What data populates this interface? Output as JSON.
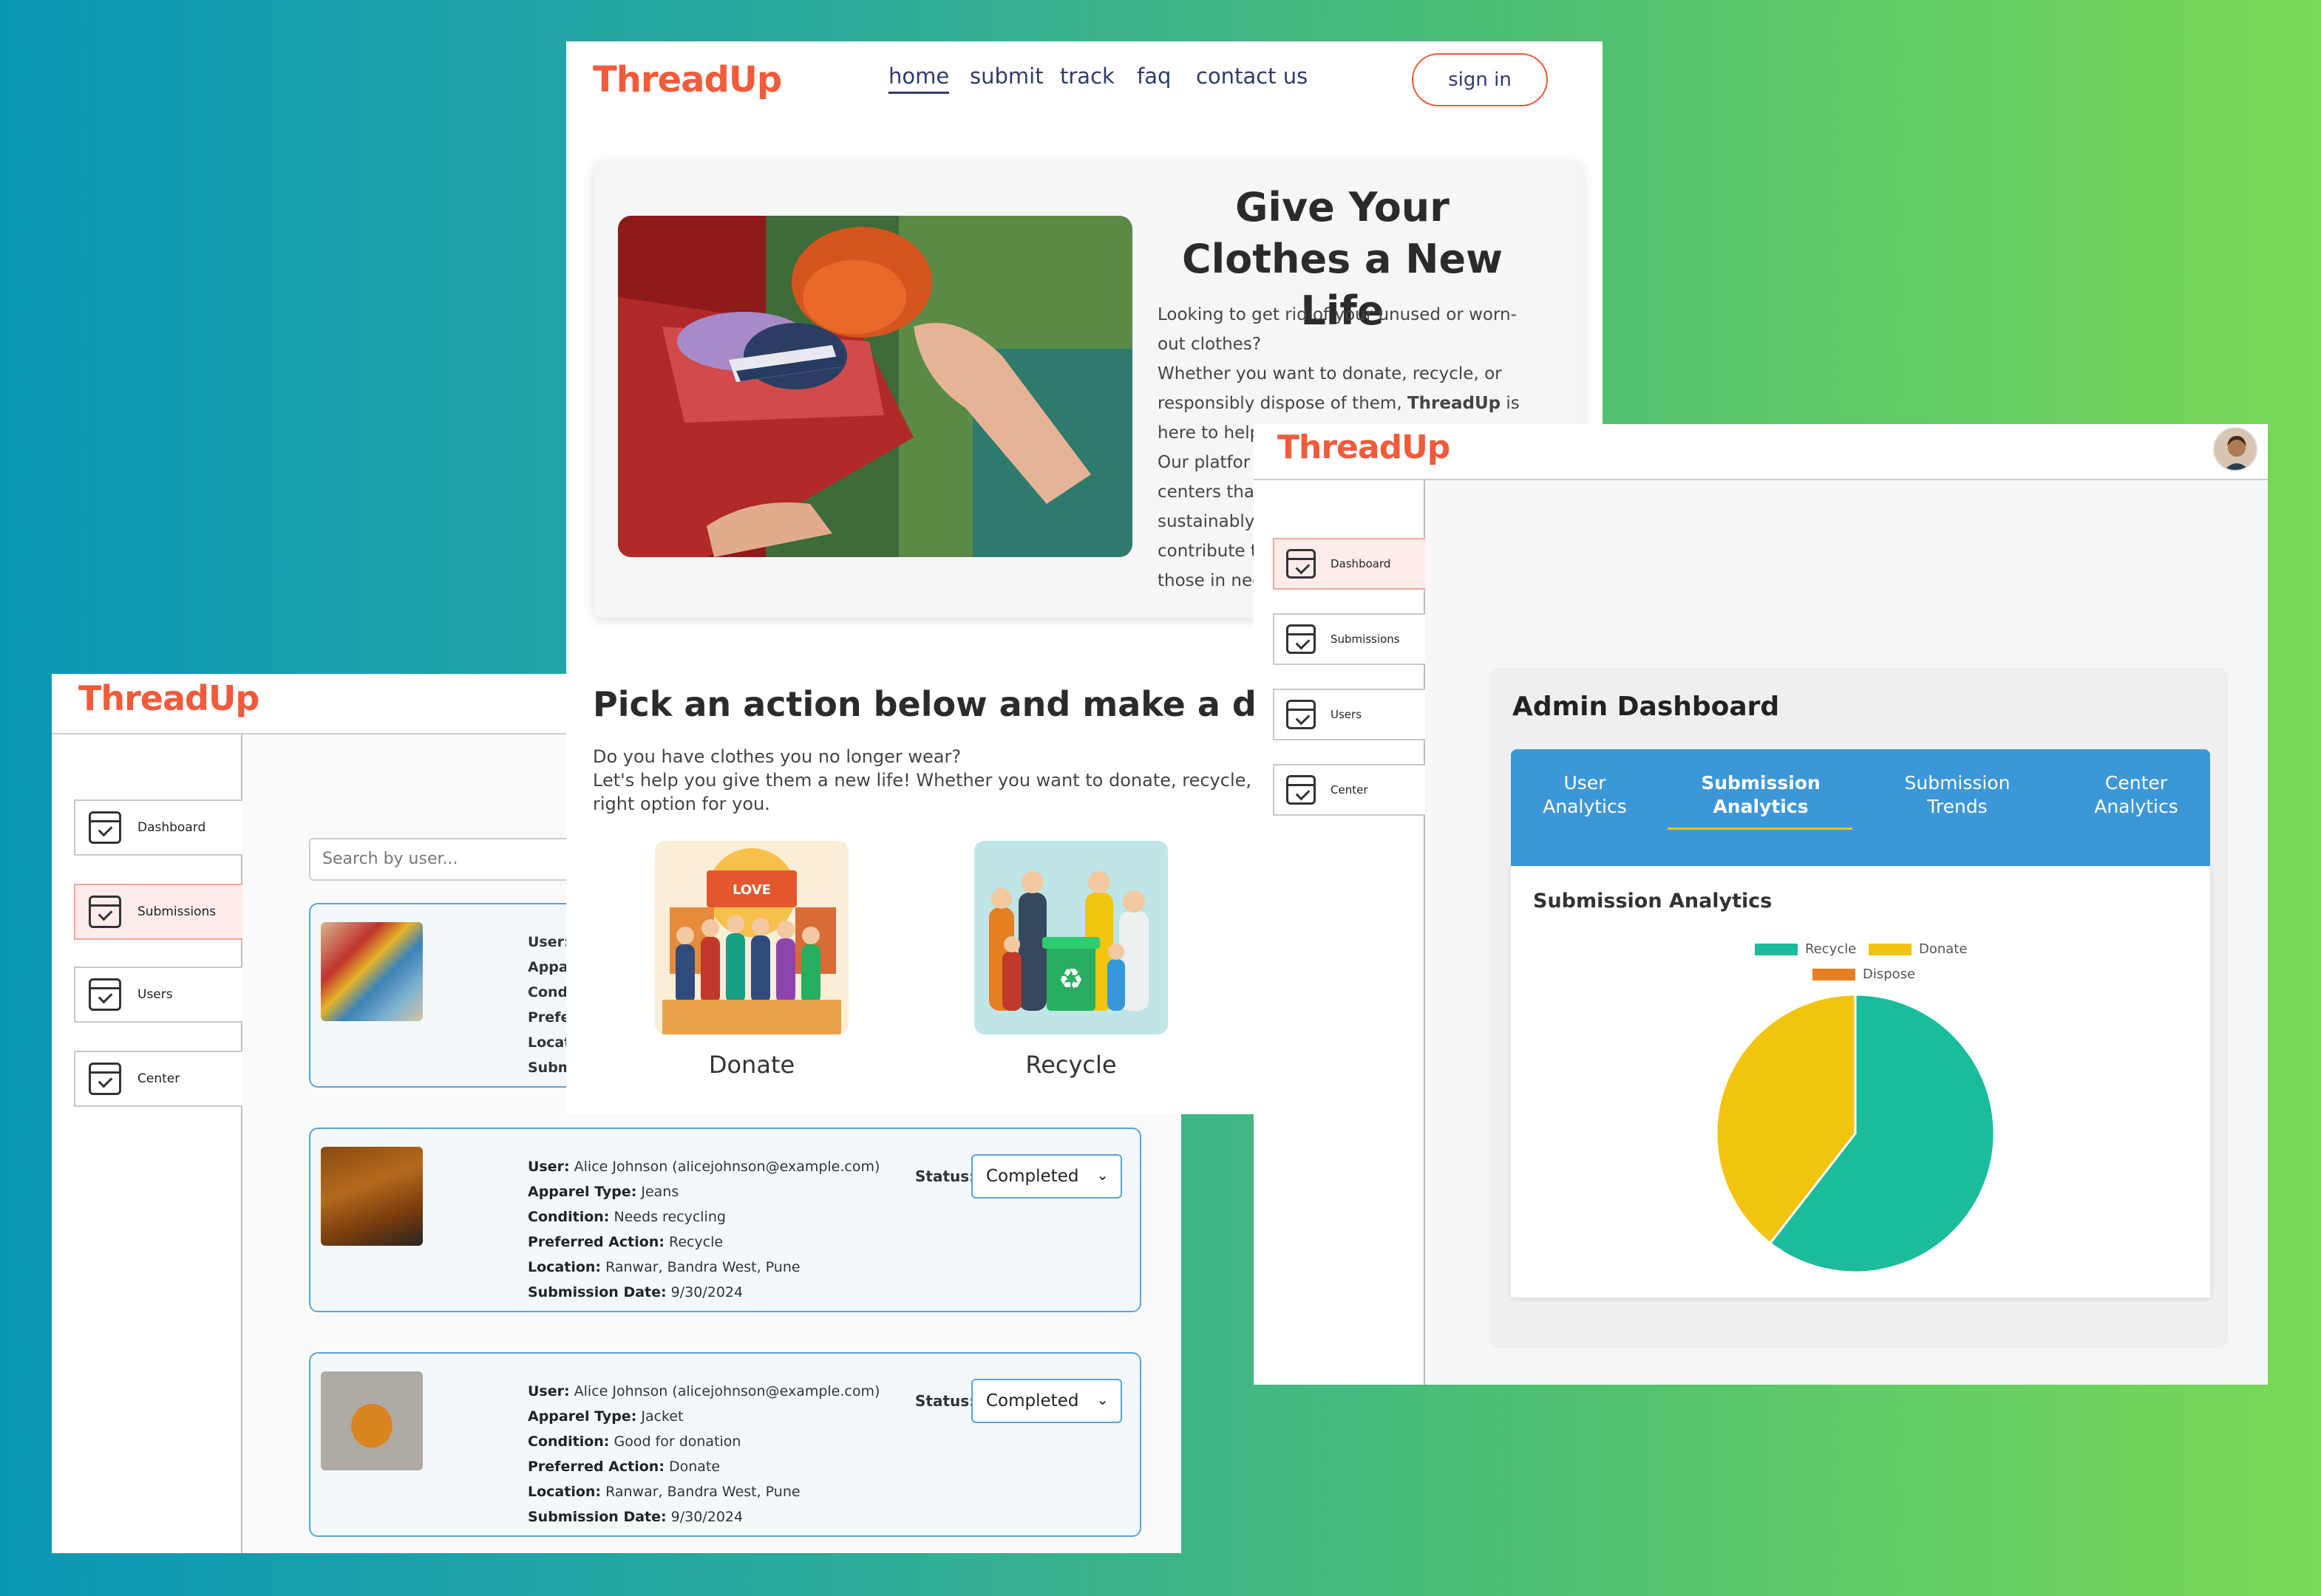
{
  "brand": "ThreadUp",
  "colors": {
    "brand": "#f15a3a",
    "accent": "#3c97d8",
    "recycle": "#1abc9c",
    "donate": "#f1c40f",
    "dispose": "#e67e22"
  },
  "submissions_window": {
    "sidebar": [
      "Dashboard",
      "Submissions",
      "Users",
      "Center"
    ],
    "search_placeholder": "Search by user...",
    "first_card_labels": [
      "User:",
      "Appa",
      "Condi",
      "Prefe",
      "Locat",
      "Subm"
    ],
    "cards": [
      {
        "user_label": "User:",
        "user": "Alice Johnson (alicejohnson@example.com)",
        "apparel_label": "Apparel Type:",
        "apparel": "Jeans",
        "condition_label": "Condition:",
        "condition": "Needs recycling",
        "action_label": "Preferred Action:",
        "action": "Recycle",
        "location_label": "Location:",
        "location": "Ranwar, Bandra West, Pune",
        "date_label": "Submission Date:",
        "date": "9/30/2024",
        "status_label": "Status:",
        "status": "Completed"
      },
      {
        "user_label": "User:",
        "user": "Alice Johnson (alicejohnson@example.com)",
        "apparel_label": "Apparel Type:",
        "apparel": "Jacket",
        "condition_label": "Condition:",
        "condition": "Good for donation",
        "action_label": "Preferred Action:",
        "action": "Donate",
        "location_label": "Location:",
        "location": "Ranwar, Bandra West, Pune",
        "date_label": "Submission Date:",
        "date": "9/30/2024",
        "status_label": "Status:",
        "status": "Completed"
      }
    ]
  },
  "home_window": {
    "nav": [
      "home",
      "submit",
      "track",
      "faq",
      "contact us"
    ],
    "signin": "sign in",
    "hero_title": "Give Your Clothes a New Life",
    "hero_lines": [
      "Looking to get rid of your unused or worn-",
      "out clothes?",
      "Whether you want to donate, recycle, or",
      "here to help",
      "Our platfor",
      "centers that",
      "sustainably,",
      "contribute t",
      "those in nee"
    ],
    "hero_line7_pre": "responsibly dispose of them, ",
    "hero_line7_bold": "ThreadUp",
    "hero_line7_post": " is",
    "pick_title": "Pick an action below and make a differe",
    "pick_line1": "Do you have clothes you no longer wear?",
    "pick_line2": "Let's help you give them a new life! Whether you want to donate, recycle, or dispo",
    "pick_line3": "right option for you.",
    "tiles": [
      "Donate",
      "Recycle"
    ],
    "donate_banner": "LOVE"
  },
  "admin_window": {
    "sidebar": [
      "Dashboard",
      "Submissions",
      "Users",
      "Center"
    ],
    "title": "Admin Dashboard",
    "tabs": [
      [
        "User",
        "Analytics"
      ],
      [
        "Submission",
        "Analytics"
      ],
      [
        "Submission",
        "Trends"
      ],
      [
        "Center",
        "Analytics"
      ]
    ],
    "chart_title": "Submission Analytics"
  },
  "chart_data": {
    "type": "pie",
    "title": "Submission Analytics",
    "categories": [
      "Recycle",
      "Donate",
      "Dispose"
    ],
    "values": [
      60.5,
      39.5,
      0
    ],
    "colors": [
      "#1abc9c",
      "#f1c40f",
      "#e67e22"
    ],
    "legend": "top"
  }
}
